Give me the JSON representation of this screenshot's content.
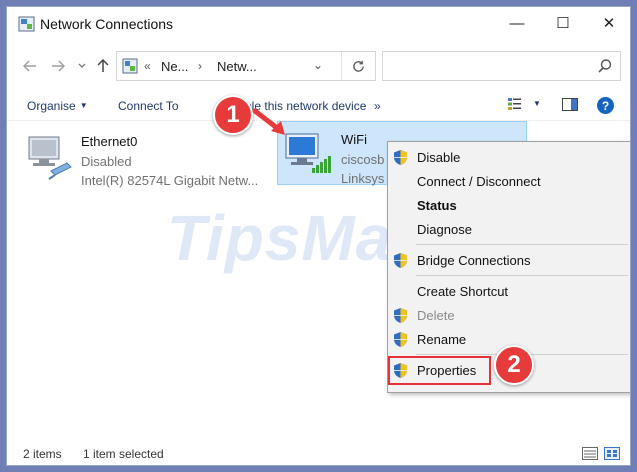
{
  "window": {
    "title": "Network Connections",
    "controls": {
      "minimize": "—",
      "maximize": "☐",
      "close": "✕"
    }
  },
  "address_bar": {
    "prefix": "«",
    "crumbs": [
      "Ne...",
      "Netw..."
    ],
    "search_placeholder": ""
  },
  "toolbar": {
    "organise": "Organise",
    "connect_to": "Connect To",
    "disable_device": "Disable this network device",
    "more": "»",
    "help": "?"
  },
  "connections": [
    {
      "name": "Ethernet0",
      "status": "Disabled",
      "device": "Intel(R) 82574L Gigabit Netw..."
    },
    {
      "name": "WiFi",
      "status": "ciscosb",
      "device": "Linksys"
    }
  ],
  "watermark": "TipsMake",
  "context_menu": {
    "items": [
      {
        "label": "Disable",
        "shield": true,
        "style": "normal"
      },
      {
        "label": "Connect / Disconnect",
        "shield": false,
        "style": "normal"
      },
      {
        "label": "Status",
        "shield": false,
        "style": "bold"
      },
      {
        "label": "Diagnose",
        "shield": false,
        "style": "normal"
      },
      {
        "label": "Bridge Connections",
        "shield": true,
        "style": "normal"
      },
      {
        "label": "Create Shortcut",
        "shield": false,
        "style": "normal"
      },
      {
        "label": "Delete",
        "shield": true,
        "style": "disabled"
      },
      {
        "label": "Rename",
        "shield": true,
        "style": "normal"
      },
      {
        "label": "Properties",
        "shield": true,
        "style": "normal"
      }
    ]
  },
  "annotations": {
    "step1": "1",
    "step2": "2",
    "accent": "#e73a3a"
  },
  "status_bar": {
    "items": "2 items",
    "selected": "1 item selected"
  }
}
